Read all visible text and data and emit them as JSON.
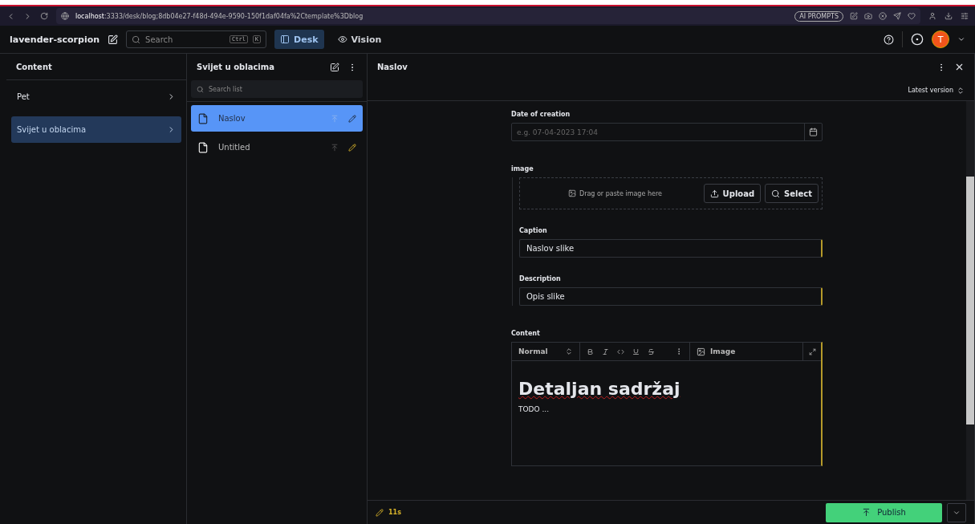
{
  "browser": {
    "url_host": "localhost",
    "url_rest": ":3333/desk/blog;8db04e27-f48d-494e-9590-150f1daf04fa%2Ctemplate%3Dblog",
    "badge": "AI PROMPTS"
  },
  "header": {
    "project": "lavender-scorpion",
    "search": {
      "placeholder": "Search"
    },
    "keys": [
      "Ctrl",
      "K"
    ],
    "tabs": [
      {
        "label": "Desk",
        "selected": true
      },
      {
        "label": "Vision",
        "selected": false
      }
    ],
    "avatar": "T"
  },
  "content_pane": {
    "title": "Content",
    "items": [
      {
        "label": "Pet",
        "selected": false
      },
      {
        "label": "Svijet u oblacima",
        "selected": true
      }
    ]
  },
  "list_pane": {
    "title": "Svijet u oblacima",
    "search": {
      "placeholder": "Search list"
    },
    "documents": [
      {
        "title": "Naslov",
        "selected": true
      },
      {
        "title": "Untitled",
        "selected": false
      }
    ]
  },
  "editor": {
    "title": "Naslov",
    "version": "Latest version",
    "date": {
      "label": "Date of creation",
      "placeholder": "e.g. 07-04-2023 17:04"
    },
    "image": {
      "label": "image",
      "drop_hint": "Drag or paste image here",
      "upload": "Upload",
      "select": "Select",
      "fields": [
        {
          "label": "Caption",
          "value": "Naslov slike"
        },
        {
          "label": "Description",
          "value": "Opis slike"
        }
      ]
    },
    "content": {
      "label": "Content",
      "style": "Normal",
      "image_button": "Image",
      "heading": "Detaljan sadržaj",
      "paragraph": "TODO ..."
    }
  },
  "footer": {
    "status": "11s",
    "publish": "Publish"
  }
}
